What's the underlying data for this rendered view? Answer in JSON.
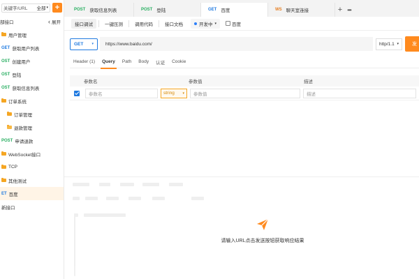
{
  "sidebar": {
    "search_placeholder": "关键字/URL",
    "filter_label": "全部",
    "row2_label": "部接口",
    "expand_label": "展开",
    "items": [
      {
        "kind": "folder",
        "indent": 1,
        "method": "",
        "label": "用户管理"
      },
      {
        "kind": "api",
        "indent": 1,
        "method": "GET",
        "method_color": "#1f7ae0",
        "label": "获取用户列表"
      },
      {
        "kind": "api",
        "indent": 1,
        "method": "OST",
        "method_color": "#27ae60",
        "label": "创建用户"
      },
      {
        "kind": "api",
        "indent": 1,
        "method": "OST",
        "method_color": "#27ae60",
        "label": "登陆"
      },
      {
        "kind": "api",
        "indent": 1,
        "method": "OST",
        "method_color": "#27ae60",
        "label": "获取信息列表"
      },
      {
        "kind": "folder",
        "indent": 1,
        "method": "",
        "label": "订单系统"
      },
      {
        "kind": "folder",
        "indent": 2,
        "method": "",
        "label": "订单管理"
      },
      {
        "kind": "folder-open",
        "indent": 2,
        "method": "",
        "label": "退款管理"
      },
      {
        "kind": "api",
        "indent": 1,
        "method": "POST",
        "method_color": "#27ae60",
        "label": "申请退款"
      },
      {
        "kind": "folder",
        "indent": 1,
        "method": "",
        "label": "WebSocket接口"
      },
      {
        "kind": "folder",
        "indent": 1,
        "method": "",
        "label": "TCP"
      },
      {
        "kind": "folder",
        "indent": 1,
        "method": "",
        "label": "其他测试"
      },
      {
        "kind": "api",
        "indent": 1,
        "method": "ET",
        "method_color": "#1f7ae0",
        "label": "百度",
        "selected": true
      },
      {
        "kind": "plain",
        "indent": 1,
        "method": "",
        "label": "新接口"
      }
    ]
  },
  "tabs": [
    {
      "method": "POST",
      "method_color": "#27ae60",
      "label": "获取信息列表",
      "active": false
    },
    {
      "method": "POST",
      "method_color": "#27ae60",
      "label": "登陆",
      "active": false
    },
    {
      "method": "GET",
      "method_color": "#1f7ae0",
      "label": "百度",
      "active": true
    },
    {
      "method": "WS",
      "method_color": "#e67e22",
      "label": "聊天室连接",
      "active": false
    }
  ],
  "tab_plus": "+",
  "tab_more": "•••",
  "subbar": {
    "buttons": [
      "接口调试",
      "一键压测",
      "调用代码",
      "接口文档"
    ],
    "env_label": "开发中",
    "env_name": "百度"
  },
  "request": {
    "method": "GET",
    "url": "https://www.baidu.com/",
    "http_version": "http/1.1",
    "send_label": "发"
  },
  "param_tabs": [
    "Header (1)",
    "Query",
    "Path",
    "Body",
    "认证",
    "Cookie"
  ],
  "param_tab_active": 1,
  "param_table": {
    "headers": [
      "参数名",
      "参数值",
      "描述"
    ],
    "row": {
      "name_placeholder": "参数名",
      "type": "string",
      "value_placeholder": "参数值",
      "desc_placeholder": "描述"
    }
  },
  "response": {
    "empty_message": "请输入URL点击发送按钮获取响应结果"
  },
  "colors": {
    "accent": "#ff8a1e",
    "primary": "#1f7ae0",
    "post": "#27ae60"
  }
}
